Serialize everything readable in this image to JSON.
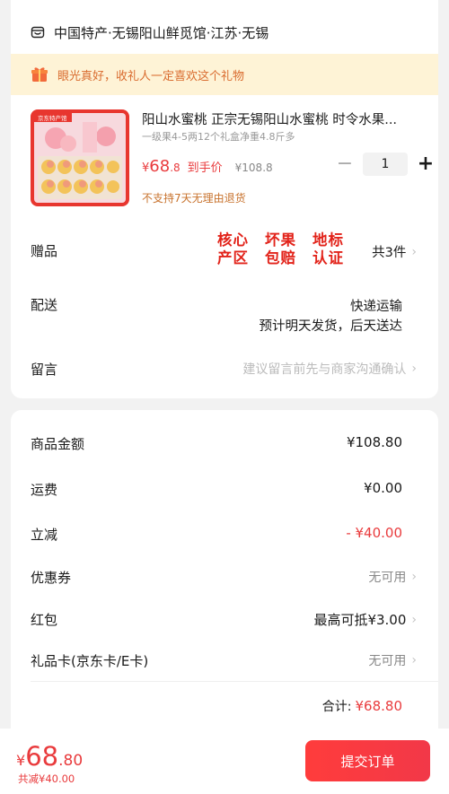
{
  "shop": {
    "name": "中国特产·无锡阳山鲜觅馆·江苏·无锡",
    "icon": "shop-icon"
  },
  "notice": {
    "text": "眼光真好，收礼人一定喜欢这个礼物",
    "icon": "gift-box-icon"
  },
  "product": {
    "title": "阳山水蜜桃 正宗无锡阳山水蜜桃 时令水果...",
    "spec": "一级果4-5两12个礼盒净重4.8斤多",
    "price_currency": "¥",
    "price_int": "68",
    "price_dec": ".8",
    "price_label": "到手价",
    "original_price": "¥108.8",
    "quantity": "1",
    "minus": "−",
    "plus": "+",
    "return_policy": "不支持7天无理由退货",
    "image_logo": "京东特产馆"
  },
  "gifts": {
    "label": "赠品",
    "badges": [
      {
        "line1": "核心",
        "line2": "产区"
      },
      {
        "line1": "坏果",
        "line2": "包赔"
      },
      {
        "line1": "地标",
        "line2": "认证"
      }
    ],
    "count": "共3件"
  },
  "delivery": {
    "label": "配送",
    "method": "快递运输",
    "eta": "预计明天发货，后天送达"
  },
  "message": {
    "label": "留言",
    "placeholder": "建议留言前先与商家沟通确认"
  },
  "summary": {
    "goods_label": "商品金额",
    "goods_value": "¥108.80",
    "shipping_label": "运费",
    "shipping_value": "¥0.00",
    "discount_label": "立减",
    "discount_value": "- ¥40.00",
    "coupon_label": "优惠券",
    "coupon_value": "无可用",
    "redpacket_label": "红包",
    "redpacket_value": "最高可抵¥3.00",
    "giftcard_label": "礼品卡(京东卡/E卡)",
    "giftcard_value": "无可用",
    "total_label": "合计:",
    "total_value": "¥68.80"
  },
  "footer": {
    "currency": "¥",
    "price_int": "68",
    "price_dec": ".80",
    "saving": "共减¥40.00",
    "submit": "提交订单"
  },
  "colors": {
    "accent": "#e93b3d",
    "notice_bg": "#fef3d6",
    "notice_text": "#d96b2e"
  }
}
